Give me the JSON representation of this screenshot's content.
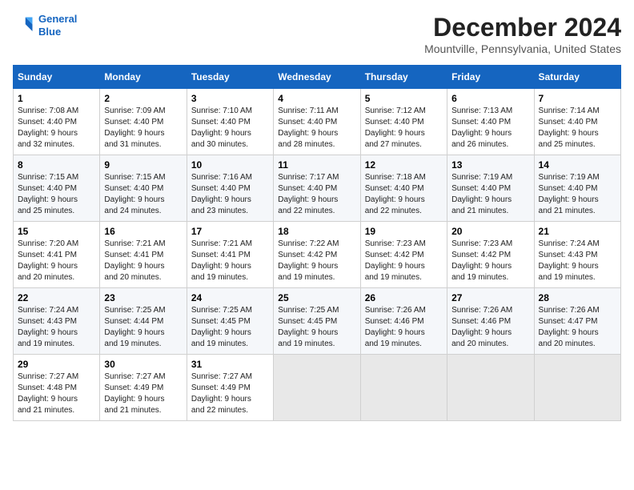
{
  "logo": {
    "line1": "General",
    "line2": "Blue"
  },
  "title": "December 2024",
  "location": "Mountville, Pennsylvania, United States",
  "days_of_week": [
    "Sunday",
    "Monday",
    "Tuesday",
    "Wednesday",
    "Thursday",
    "Friday",
    "Saturday"
  ],
  "weeks": [
    [
      {
        "day": "1",
        "sunrise": "7:08 AM",
        "sunset": "4:40 PM",
        "daylight": "9 hours and 32 minutes."
      },
      {
        "day": "2",
        "sunrise": "7:09 AM",
        "sunset": "4:40 PM",
        "daylight": "9 hours and 31 minutes."
      },
      {
        "day": "3",
        "sunrise": "7:10 AM",
        "sunset": "4:40 PM",
        "daylight": "9 hours and 30 minutes."
      },
      {
        "day": "4",
        "sunrise": "7:11 AM",
        "sunset": "4:40 PM",
        "daylight": "9 hours and 28 minutes."
      },
      {
        "day": "5",
        "sunrise": "7:12 AM",
        "sunset": "4:40 PM",
        "daylight": "9 hours and 27 minutes."
      },
      {
        "day": "6",
        "sunrise": "7:13 AM",
        "sunset": "4:40 PM",
        "daylight": "9 hours and 26 minutes."
      },
      {
        "day": "7",
        "sunrise": "7:14 AM",
        "sunset": "4:40 PM",
        "daylight": "9 hours and 25 minutes."
      }
    ],
    [
      {
        "day": "8",
        "sunrise": "7:15 AM",
        "sunset": "4:40 PM",
        "daylight": "9 hours and 25 minutes."
      },
      {
        "day": "9",
        "sunrise": "7:15 AM",
        "sunset": "4:40 PM",
        "daylight": "9 hours and 24 minutes."
      },
      {
        "day": "10",
        "sunrise": "7:16 AM",
        "sunset": "4:40 PM",
        "daylight": "9 hours and 23 minutes."
      },
      {
        "day": "11",
        "sunrise": "7:17 AM",
        "sunset": "4:40 PM",
        "daylight": "9 hours and 22 minutes."
      },
      {
        "day": "12",
        "sunrise": "7:18 AM",
        "sunset": "4:40 PM",
        "daylight": "9 hours and 22 minutes."
      },
      {
        "day": "13",
        "sunrise": "7:19 AM",
        "sunset": "4:40 PM",
        "daylight": "9 hours and 21 minutes."
      },
      {
        "day": "14",
        "sunrise": "7:19 AM",
        "sunset": "4:40 PM",
        "daylight": "9 hours and 21 minutes."
      }
    ],
    [
      {
        "day": "15",
        "sunrise": "7:20 AM",
        "sunset": "4:41 PM",
        "daylight": "9 hours and 20 minutes."
      },
      {
        "day": "16",
        "sunrise": "7:21 AM",
        "sunset": "4:41 PM",
        "daylight": "9 hours and 20 minutes."
      },
      {
        "day": "17",
        "sunrise": "7:21 AM",
        "sunset": "4:41 PM",
        "daylight": "9 hours and 19 minutes."
      },
      {
        "day": "18",
        "sunrise": "7:22 AM",
        "sunset": "4:42 PM",
        "daylight": "9 hours and 19 minutes."
      },
      {
        "day": "19",
        "sunrise": "7:23 AM",
        "sunset": "4:42 PM",
        "daylight": "9 hours and 19 minutes."
      },
      {
        "day": "20",
        "sunrise": "7:23 AM",
        "sunset": "4:42 PM",
        "daylight": "9 hours and 19 minutes."
      },
      {
        "day": "21",
        "sunrise": "7:24 AM",
        "sunset": "4:43 PM",
        "daylight": "9 hours and 19 minutes."
      }
    ],
    [
      {
        "day": "22",
        "sunrise": "7:24 AM",
        "sunset": "4:43 PM",
        "daylight": "9 hours and 19 minutes."
      },
      {
        "day": "23",
        "sunrise": "7:25 AM",
        "sunset": "4:44 PM",
        "daylight": "9 hours and 19 minutes."
      },
      {
        "day": "24",
        "sunrise": "7:25 AM",
        "sunset": "4:45 PM",
        "daylight": "9 hours and 19 minutes."
      },
      {
        "day": "25",
        "sunrise": "7:25 AM",
        "sunset": "4:45 PM",
        "daylight": "9 hours and 19 minutes."
      },
      {
        "day": "26",
        "sunrise": "7:26 AM",
        "sunset": "4:46 PM",
        "daylight": "9 hours and 19 minutes."
      },
      {
        "day": "27",
        "sunrise": "7:26 AM",
        "sunset": "4:46 PM",
        "daylight": "9 hours and 20 minutes."
      },
      {
        "day": "28",
        "sunrise": "7:26 AM",
        "sunset": "4:47 PM",
        "daylight": "9 hours and 20 minutes."
      }
    ],
    [
      {
        "day": "29",
        "sunrise": "7:27 AM",
        "sunset": "4:48 PM",
        "daylight": "9 hours and 21 minutes."
      },
      {
        "day": "30",
        "sunrise": "7:27 AM",
        "sunset": "4:49 PM",
        "daylight": "9 hours and 21 minutes."
      },
      {
        "day": "31",
        "sunrise": "7:27 AM",
        "sunset": "4:49 PM",
        "daylight": "9 hours and 22 minutes."
      },
      null,
      null,
      null,
      null
    ]
  ],
  "labels": {
    "sunrise": "Sunrise:",
    "sunset": "Sunset:",
    "daylight": "Daylight:"
  }
}
